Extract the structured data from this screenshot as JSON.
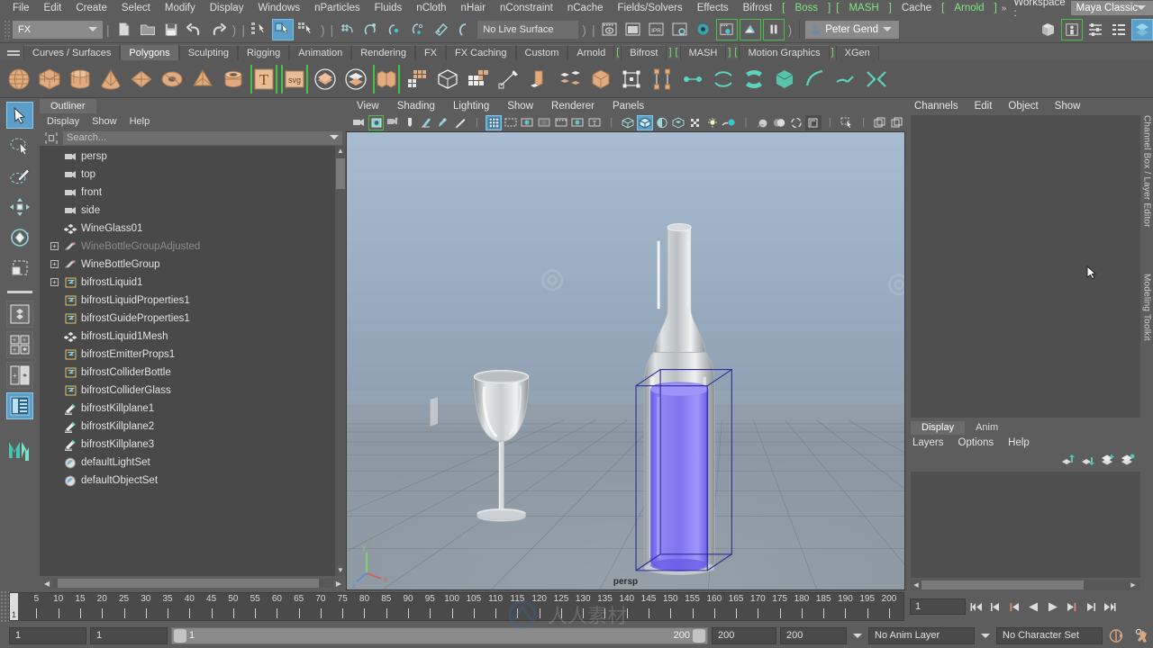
{
  "app": {
    "title": "Autodesk Maya",
    "accent_blue": "#5a9ec9",
    "accent_green": "#45c245",
    "bg": "#5d5d5d"
  },
  "menubar": {
    "items": [
      {
        "label": "File"
      },
      {
        "label": "Edit"
      },
      {
        "label": "Create"
      },
      {
        "label": "Select"
      },
      {
        "label": "Modify"
      },
      {
        "label": "Display"
      },
      {
        "label": "Windows"
      },
      {
        "label": "nParticles"
      },
      {
        "label": "Fluids"
      },
      {
        "label": "nCloth"
      },
      {
        "label": "nHair"
      },
      {
        "label": "nConstraint"
      },
      {
        "label": "nCache"
      },
      {
        "label": "Fields/Solvers"
      },
      {
        "label": "Effects"
      },
      {
        "label": "Bifrost"
      }
    ],
    "bracket_items": [
      {
        "label": "Boss"
      },
      {
        "label": "MASH"
      }
    ],
    "cache_label": "Cache",
    "arnold_label": "Arnold",
    "overflow": "»",
    "workspace_label": "Workspace :",
    "workspace_value": "Maya Classic"
  },
  "statusline": {
    "menuset_value": "FX",
    "live_surface": "No Live Surface",
    "user_name": "Peter Gend",
    "icons": [
      "new-scene-icon",
      "open-scene-icon",
      "save-scene-icon",
      "undo-icon",
      "redo-icon",
      "select-by-hierarchy-icon",
      "select-by-object-icon",
      "select-by-component-icon",
      "snap-to-grid-icon",
      "snap-to-curve-icon",
      "snap-to-point-icon",
      "snap-to-projected-center-icon",
      "snap-to-view-plane-icon",
      "make-live-icon",
      "render-current-frame-icon",
      "ipr-render-icon",
      "render-settings-icon",
      "hypershade-icon",
      "render-view-icon",
      "render-sequence-icon",
      "render-setup-icon",
      "show-hide-editors-icon",
      "attribute-editor-icon",
      "tool-settings-icon",
      "channel-box-icon",
      "modeling-toolkit-icon"
    ]
  },
  "shelf": {
    "tabs": [
      {
        "label": "Curves / Surfaces",
        "active": false
      },
      {
        "label": "Polygons",
        "active": true
      },
      {
        "label": "Sculpting",
        "active": false
      },
      {
        "label": "Rigging",
        "active": false
      },
      {
        "label": "Animation",
        "active": false
      },
      {
        "label": "Rendering",
        "active": false
      },
      {
        "label": "FX",
        "active": false
      },
      {
        "label": "FX Caching",
        "active": false
      },
      {
        "label": "Custom",
        "active": false
      },
      {
        "label": "Arnold",
        "active": false
      },
      {
        "label": "Bifrost",
        "active": false,
        "bracketed": true
      },
      {
        "label": "MASH",
        "active": false,
        "bracketed": true
      },
      {
        "label": "Motion Graphics",
        "active": false,
        "bracketed": true
      },
      {
        "label": "XGen",
        "active": false
      }
    ],
    "icons": [
      "poly-sphere-icon",
      "poly-cube-icon",
      "poly-cylinder-icon",
      "poly-cone-icon",
      "poly-plane-icon",
      "poly-torus-icon",
      "poly-pyramid-icon",
      "poly-pipe-icon",
      "poly-type-icon",
      "poly-svg-icon",
      "combine-icon",
      "separate-icon",
      "boolean-icon",
      "smooth-icon",
      "mirror-icon",
      "multi-cut-icon",
      "extrude-icon",
      "bevel-icon",
      "bridge-icon",
      "target-weld-icon",
      "quad-draw-icon",
      "sculpt-icon",
      "soft-select-icon",
      "transfer-attributes-icon",
      "poly-clean-icon",
      "uv-editor-icon",
      "symmetry-icon",
      "crease-icon",
      "chamfer-icon"
    ]
  },
  "toolbox": {
    "items": [
      {
        "name": "select-tool",
        "selected": true
      },
      {
        "name": "lasso-select-tool",
        "selected": false
      },
      {
        "name": "paint-select-tool",
        "selected": false
      },
      {
        "name": "move-tool",
        "selected": false
      },
      {
        "name": "rotate-tool",
        "selected": false
      },
      {
        "name": "scale-tool",
        "selected": false
      }
    ],
    "layouts": [
      {
        "name": "single-perspective-layout",
        "selected": false
      },
      {
        "name": "four-view-layout",
        "selected": false
      },
      {
        "name": "two-pane-layout",
        "selected": false
      },
      {
        "name": "persp-outliner-layout",
        "selected": true
      }
    ],
    "logo": "maya-m-logo"
  },
  "outliner": {
    "tab_label": "Outliner",
    "menus": [
      "Display",
      "Show",
      "Help"
    ],
    "search_placeholder": "Search...",
    "search_value": "",
    "items": [
      {
        "label": "persp",
        "icon": "camera-icon",
        "indent": 1,
        "expander": false,
        "dim": false
      },
      {
        "label": "top",
        "icon": "camera-icon",
        "indent": 1,
        "expander": false,
        "dim": false
      },
      {
        "label": "front",
        "icon": "camera-icon",
        "indent": 1,
        "expander": false,
        "dim": false
      },
      {
        "label": "side",
        "icon": "camera-icon",
        "indent": 1,
        "expander": false,
        "dim": false
      },
      {
        "label": "WineGlass01",
        "icon": "mesh-icon",
        "indent": 1,
        "expander": false,
        "dim": false
      },
      {
        "label": "WineBottleGroupAdjusted",
        "icon": "group-icon",
        "indent": 1,
        "expander": true,
        "dim": true
      },
      {
        "label": "WineBottleGroup",
        "icon": "group-icon",
        "indent": 1,
        "expander": true,
        "dim": false
      },
      {
        "label": "bifrostLiquid1",
        "icon": "bifrost-icon",
        "indent": 1,
        "expander": true,
        "dim": false
      },
      {
        "label": "bifrostLiquidProperties1",
        "icon": "bifrost-icon",
        "indent": 1,
        "expander": false,
        "dim": false
      },
      {
        "label": "bifrostGuideProperties1",
        "icon": "bifrost-icon",
        "indent": 1,
        "expander": false,
        "dim": false
      },
      {
        "label": "bifrostLiquid1Mesh",
        "icon": "mesh-icon",
        "indent": 1,
        "expander": false,
        "dim": false
      },
      {
        "label": "bifrostEmitterProps1",
        "icon": "bifrost-icon",
        "indent": 1,
        "expander": false,
        "dim": false
      },
      {
        "label": "bifrostColliderBottle",
        "icon": "bifrost-icon",
        "indent": 1,
        "expander": false,
        "dim": false
      },
      {
        "label": "bifrostColliderGlass",
        "icon": "bifrost-icon",
        "indent": 1,
        "expander": false,
        "dim": false
      },
      {
        "label": "bifrostKillplane1",
        "icon": "killplane-icon",
        "indent": 1,
        "expander": false,
        "dim": false
      },
      {
        "label": "bifrostKillplane2",
        "icon": "killplane-icon",
        "indent": 1,
        "expander": false,
        "dim": false
      },
      {
        "label": "bifrostKillplane3",
        "icon": "killplane-icon",
        "indent": 1,
        "expander": false,
        "dim": false
      },
      {
        "label": "defaultLightSet",
        "icon": "set-icon",
        "indent": 1,
        "expander": false,
        "dim": false
      },
      {
        "label": "defaultObjectSet",
        "icon": "set-icon",
        "indent": 1,
        "expander": false,
        "dim": false
      }
    ]
  },
  "viewport": {
    "menus": [
      "View",
      "Shading",
      "Lighting",
      "Show",
      "Renderer",
      "Panels"
    ],
    "camera_label": "persp",
    "axis_labels": {
      "y": "y",
      "x": "x",
      "z": "z"
    },
    "icons": [
      "select-camera-icon",
      "camera-attributes-icon",
      "bookmark-icon",
      "image-plane-icon",
      "twopoint-icon",
      "grease-pencil-icon",
      "grid-icon",
      "film-gate-icon",
      "resolution-gate-icon",
      "gate-mask-icon",
      "film-origin-icon",
      "exposure-icon",
      "hud-icon",
      "wireframe-icon",
      "smooth-shade-icon",
      "shaded-wireframe-icon",
      "flat-shade-icon",
      "textured-icon",
      "use-lights-icon",
      "shadows-icon",
      "screen-space-ao-icon",
      "motion-blur-icon",
      "multisample-icon",
      "depth-of-field-icon",
      "xray-icon",
      "isolate-select-icon",
      "panel-copy-icon",
      "panel-tear-icon"
    ]
  },
  "channelbox": {
    "menus": [
      "Channels",
      "Edit",
      "Object",
      "Show"
    ],
    "side_label": "Channel Box / Layer Editor",
    "modeling_toolkit_label": "Modeling Toolkit"
  },
  "layereditor": {
    "tabs": [
      {
        "label": "Display",
        "active": true
      },
      {
        "label": "Anim",
        "active": false
      }
    ],
    "menus": [
      "Layers",
      "Options",
      "Help"
    ],
    "buttons": [
      "move-layer-up-icon",
      "move-layer-down-icon",
      "new-layer-icon",
      "new-layer-from-selected-icon"
    ]
  },
  "timeslider": {
    "ticks": [
      5,
      10,
      15,
      20,
      25,
      30,
      35,
      40,
      45,
      50,
      55,
      60,
      65,
      70,
      75,
      80,
      85,
      90,
      95,
      100,
      105,
      110,
      115,
      120,
      125,
      130,
      135,
      140,
      145,
      150,
      155,
      160,
      165,
      170,
      175,
      180,
      185,
      190,
      195,
      200
    ],
    "range_start": 1,
    "range_end": 200,
    "current_frame": 1,
    "current_frame_field": "1",
    "playback_buttons": [
      "go-to-start-icon",
      "step-back-keyframe-icon",
      "step-back-frame-icon",
      "play-backwards-icon",
      "play-forwards-icon",
      "step-forward-frame-icon",
      "step-forward-keyframe-icon",
      "go-to-end-icon"
    ]
  },
  "rangeslider": {
    "anim_start": "1",
    "playback_start": "1",
    "bar_start_label": "1",
    "bar_end_label": "200",
    "playback_end": "200",
    "anim_end": "200",
    "anim_layer": "No Anim Layer",
    "character_set": "No Character Set",
    "right_icons": [
      "auto-keyframe-icon",
      "animation-preferences-icon"
    ]
  }
}
